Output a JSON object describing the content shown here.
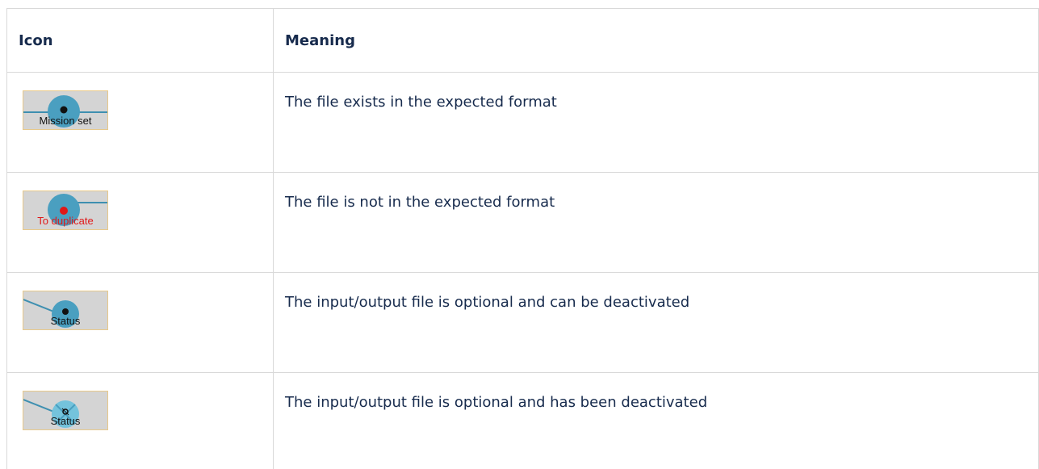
{
  "table": {
    "headers": {
      "icon": "Icon",
      "meaning": "Meaning"
    },
    "rows": [
      {
        "icon_name": "mission-set-file-icon",
        "icon_label": "Mission set",
        "label_color": "#111111",
        "dot_color": "#111111",
        "meaning": "The file exists in the expected format"
      },
      {
        "icon_name": "to-duplicate-file-icon",
        "icon_label": "To duplicate",
        "label_color": "#e01818",
        "dot_color": "#e01818",
        "meaning": "The file is not in the expected format"
      },
      {
        "icon_name": "status-optional-file-icon",
        "icon_label": "Status",
        "label_color": "#111111",
        "dot_color": "#111111",
        "meaning": "The input/output file is optional and can be deactivated"
      },
      {
        "icon_name": "status-deactivated-file-icon",
        "icon_label": "Status",
        "label_color": "#111111",
        "dot_color": "#111111",
        "meaning": "The input/output file is optional and has been deactivated"
      }
    ]
  },
  "colors": {
    "border": "#d9d9d9",
    "text": "#172b4d",
    "icon_background": "#d4d4d4",
    "icon_border": "#e8c98a",
    "node_fill": "#4a9fc0",
    "node_fill_deactivated": "#74c3dc"
  }
}
